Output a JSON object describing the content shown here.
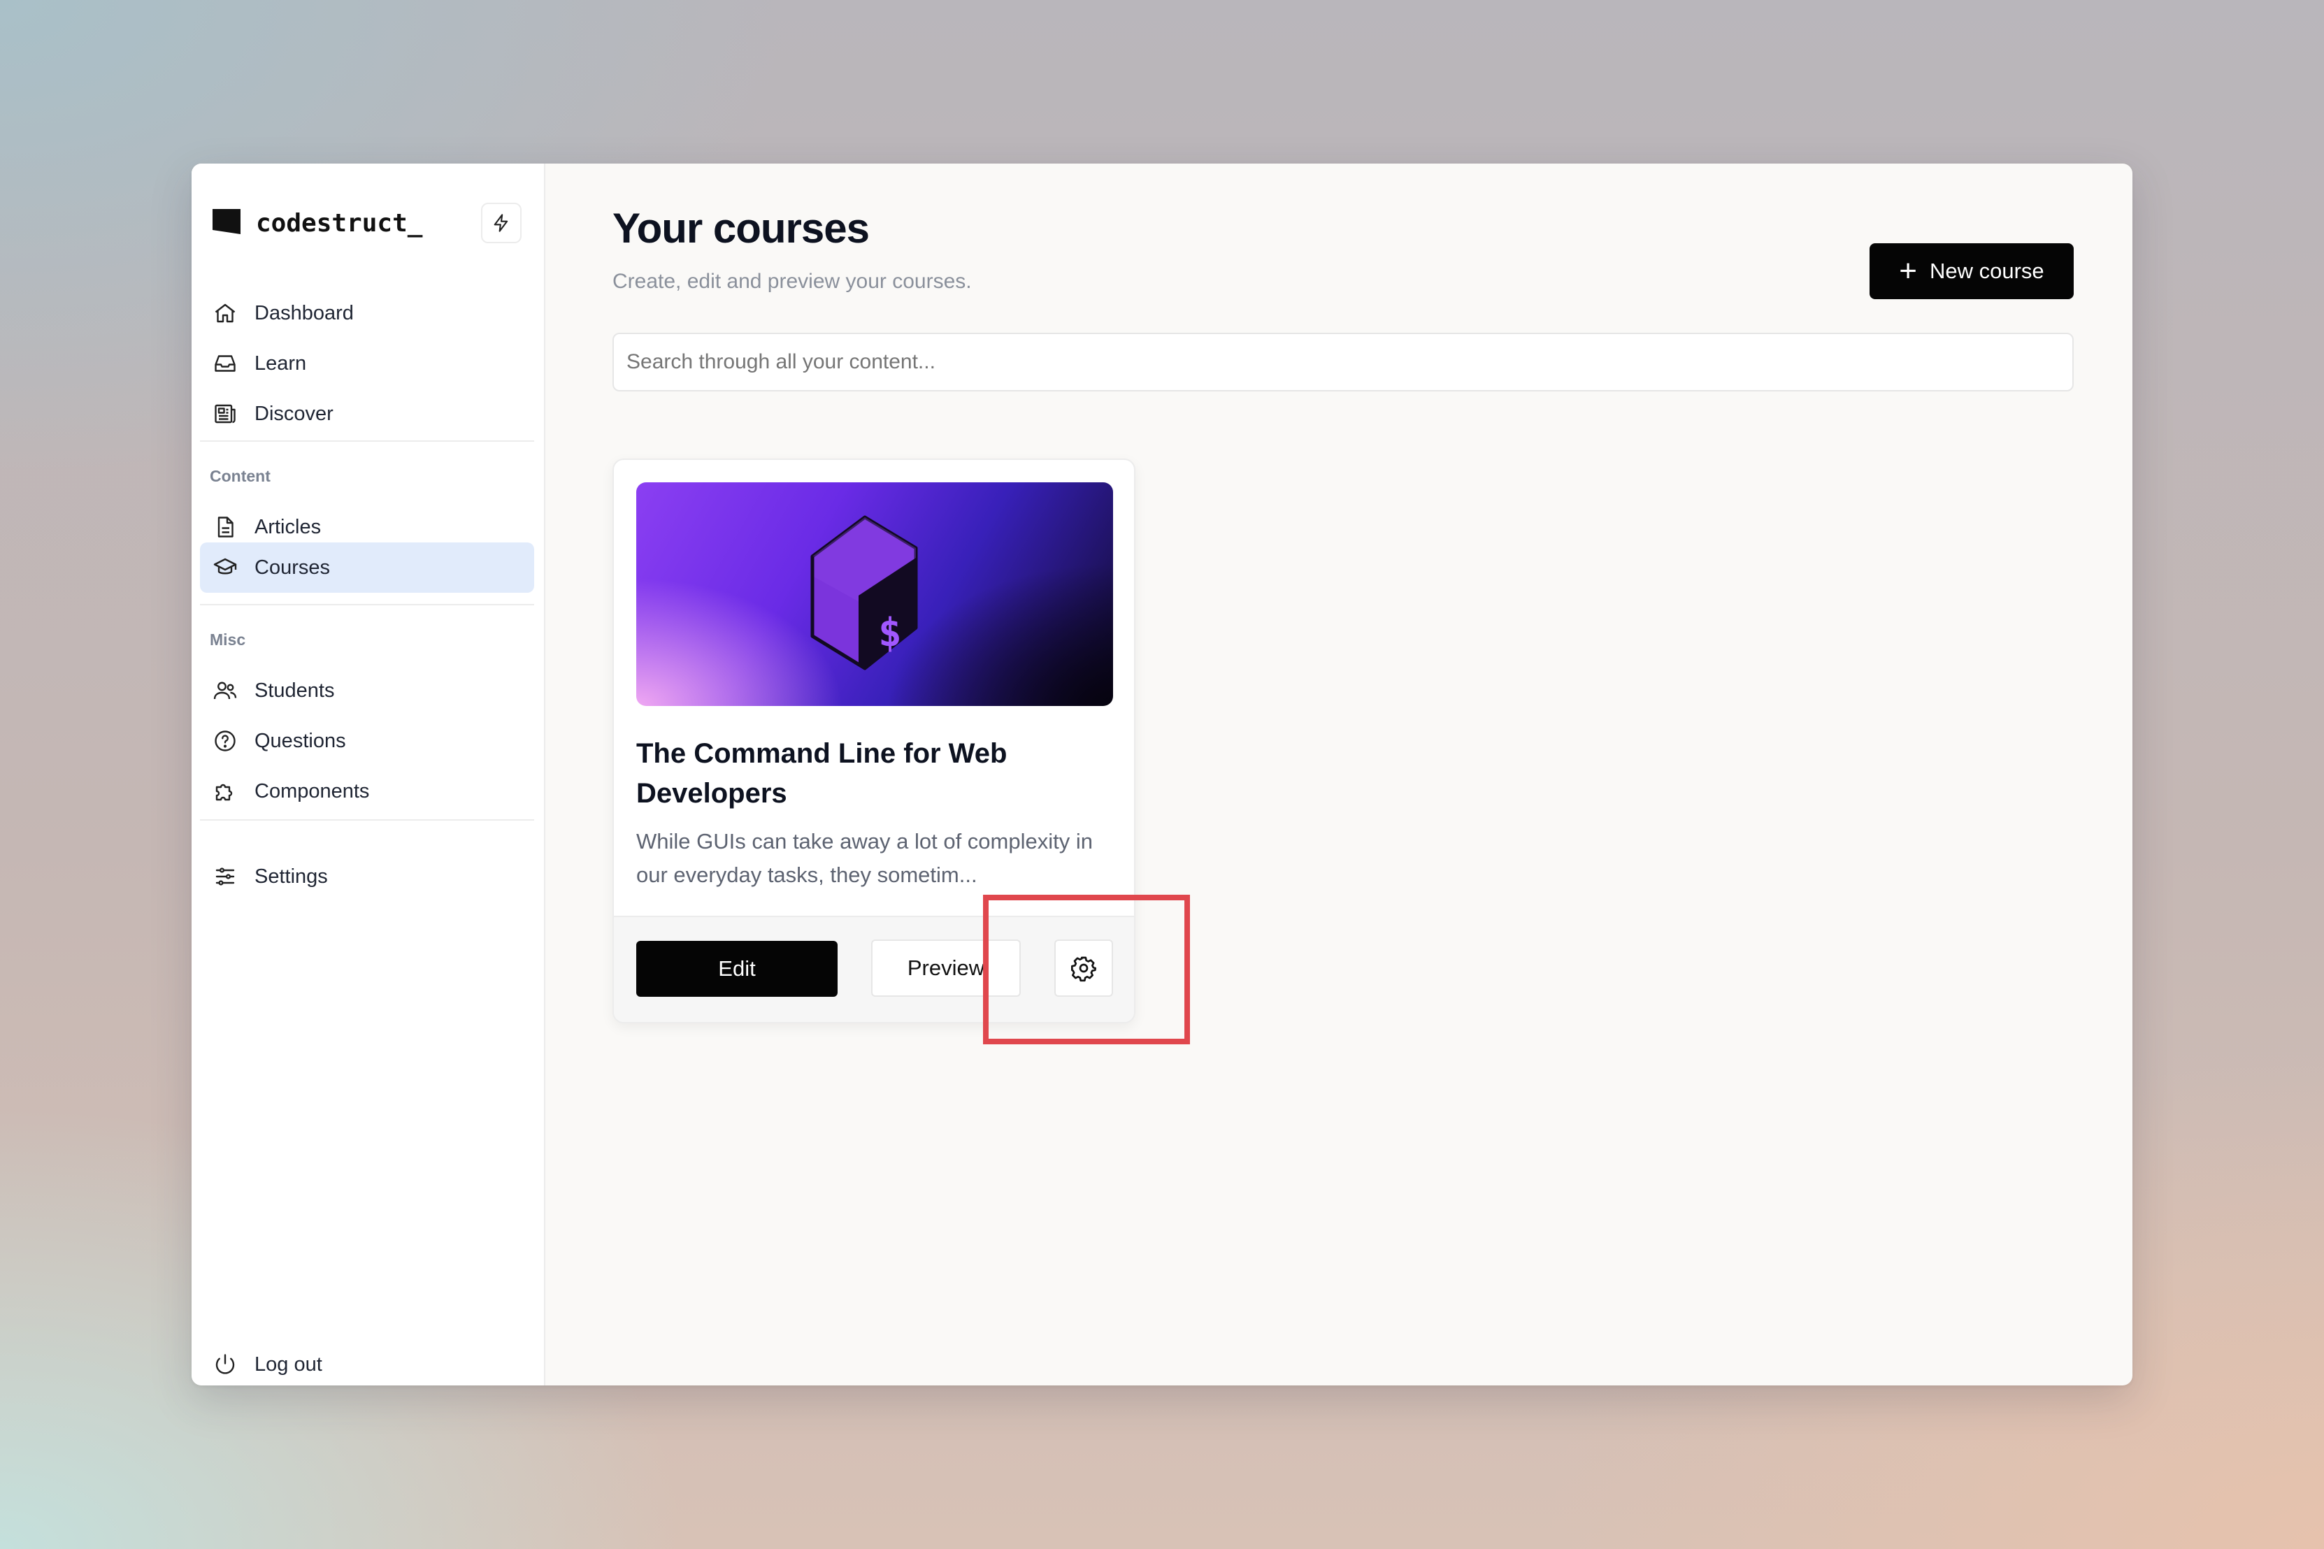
{
  "brand": {
    "name": "codestruct_"
  },
  "sidebar": {
    "nav_main": [
      {
        "label": "Dashboard",
        "icon": "home-icon"
      },
      {
        "label": "Learn",
        "icon": "inbox-icon"
      },
      {
        "label": "Discover",
        "icon": "newspaper-icon"
      }
    ],
    "content_label": "Content",
    "content_items": [
      {
        "label": "Articles",
        "icon": "document-icon"
      },
      {
        "label": "Courses",
        "icon": "graduation-cap-icon",
        "active": true
      }
    ],
    "misc_label": "Misc",
    "misc_items": [
      {
        "label": "Students",
        "icon": "users-icon"
      },
      {
        "label": "Questions",
        "icon": "question-circle-icon"
      },
      {
        "label": "Components",
        "icon": "puzzle-icon"
      }
    ],
    "settings_label": "Settings",
    "logout_label": "Log out"
  },
  "main": {
    "title": "Your courses",
    "subtitle": "Create, edit and preview your courses.",
    "new_course_label": "New course",
    "search_placeholder": "Search through all your content..."
  },
  "course_card": {
    "title": "The Command Line for Web Developers",
    "description": "While GUIs can take away a lot of complexity in our everyday tasks, they sometim...",
    "edit_label": "Edit",
    "preview_label": "Preview",
    "image_glyph": "$"
  },
  "colors": {
    "active_nav_bg": "#e1ebfb",
    "primary_button": "#050505",
    "highlight_box": "#e0474d"
  }
}
